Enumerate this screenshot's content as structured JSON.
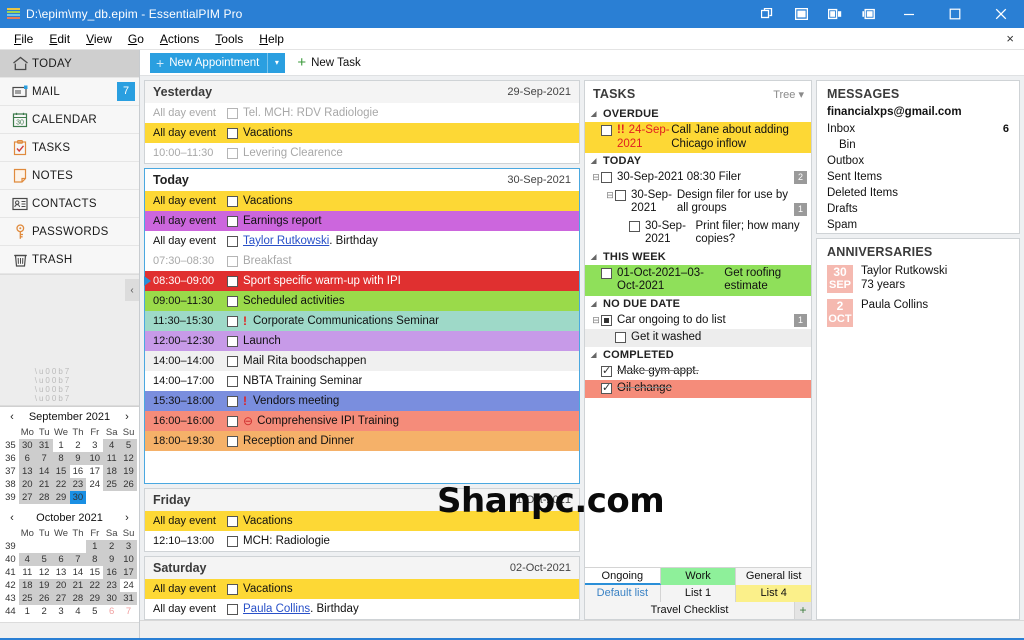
{
  "window": {
    "title": "D:\\epim\\my_db.epim - EssentialPIM Pro",
    "controls": [
      "restore-layout",
      "single-pane",
      "two-pane",
      "side-pane",
      "minimize",
      "maximize",
      "close"
    ]
  },
  "menu": {
    "items": [
      "File",
      "Edit",
      "View",
      "Go",
      "Actions",
      "Tools",
      "Help"
    ],
    "close_label": "×"
  },
  "sidebar": {
    "items": [
      {
        "label": "TODAY",
        "icon": "home-icon",
        "badge": ""
      },
      {
        "label": "MAIL",
        "icon": "envelope-icon",
        "badge": "7"
      },
      {
        "label": "CALENDAR",
        "icon": "calendar-icon",
        "badge": ""
      },
      {
        "label": "TASKS",
        "icon": "clipboard-check-icon",
        "badge": ""
      },
      {
        "label": "NOTES",
        "icon": "note-page-icon",
        "badge": ""
      },
      {
        "label": "CONTACTS",
        "icon": "contact-card-icon",
        "badge": ""
      },
      {
        "label": "PASSWORDS",
        "icon": "key-icon",
        "badge": ""
      },
      {
        "label": "TRASH",
        "icon": "trash-icon",
        "badge": ""
      }
    ],
    "collapse_label": "‹"
  },
  "minicalendars": [
    {
      "title": "September 2021",
      "prev": "‹",
      "next": "›",
      "daynames": [
        "Mo",
        "Tu",
        "We",
        "Th",
        "Fr",
        "Sa",
        "Su"
      ],
      "weeks": [
        {
          "wk": "35",
          "days": [
            {
              "n": "30",
              "cls": "out shade"
            },
            {
              "n": "31",
              "cls": "out shade"
            },
            {
              "n": "1",
              "cls": ""
            },
            {
              "n": "2",
              "cls": ""
            },
            {
              "n": "3",
              "cls": ""
            },
            {
              "n": "4",
              "cls": "sat shade"
            },
            {
              "n": "5",
              "cls": "sun shade"
            }
          ]
        },
        {
          "wk": "36",
          "days": [
            {
              "n": "6",
              "cls": "shade"
            },
            {
              "n": "7",
              "cls": "shade"
            },
            {
              "n": "8",
              "cls": "shade"
            },
            {
              "n": "9",
              "cls": "shade"
            },
            {
              "n": "10",
              "cls": "shade"
            },
            {
              "n": "11",
              "cls": "sat shade"
            },
            {
              "n": "12",
              "cls": "sun shade"
            }
          ]
        },
        {
          "wk": "37",
          "days": [
            {
              "n": "13",
              "cls": "shade"
            },
            {
              "n": "14",
              "cls": "shade"
            },
            {
              "n": "15",
              "cls": "shade"
            },
            {
              "n": "16",
              "cls": ""
            },
            {
              "n": "17",
              "cls": ""
            },
            {
              "n": "18",
              "cls": "sat shade"
            },
            {
              "n": "19",
              "cls": "sun shade"
            }
          ]
        },
        {
          "wk": "38",
          "days": [
            {
              "n": "20",
              "cls": "shade"
            },
            {
              "n": "21",
              "cls": "shade"
            },
            {
              "n": "22",
              "cls": "shade"
            },
            {
              "n": "23",
              "cls": "shade"
            },
            {
              "n": "24",
              "cls": ""
            },
            {
              "n": "25",
              "cls": "sat shade"
            },
            {
              "n": "26",
              "cls": "sun shade"
            }
          ]
        },
        {
          "wk": "39",
          "days": [
            {
              "n": "27",
              "cls": "shade"
            },
            {
              "n": "28",
              "cls": "shade"
            },
            {
              "n": "29",
              "cls": "shade"
            },
            {
              "n": "30",
              "cls": "today"
            },
            {
              "n": "",
              "cls": ""
            },
            {
              "n": "",
              "cls": ""
            },
            {
              "n": "",
              "cls": ""
            }
          ]
        }
      ]
    },
    {
      "title": "October 2021",
      "prev": "‹",
      "next": "›",
      "daynames": [
        "Mo",
        "Tu",
        "We",
        "Th",
        "Fr",
        "Sa",
        "Su"
      ],
      "weeks": [
        {
          "wk": "39",
          "days": [
            {
              "n": "",
              "cls": ""
            },
            {
              "n": "",
              "cls": ""
            },
            {
              "n": "",
              "cls": ""
            },
            {
              "n": "",
              "cls": ""
            },
            {
              "n": "1",
              "cls": "shade"
            },
            {
              "n": "2",
              "cls": "sat shade"
            },
            {
              "n": "3",
              "cls": "sun shade"
            }
          ]
        },
        {
          "wk": "40",
          "days": [
            {
              "n": "4",
              "cls": "shade"
            },
            {
              "n": "5",
              "cls": "shade"
            },
            {
              "n": "6",
              "cls": "shade"
            },
            {
              "n": "7",
              "cls": "shade"
            },
            {
              "n": "8",
              "cls": "shade"
            },
            {
              "n": "9",
              "cls": "sat shade"
            },
            {
              "n": "10",
              "cls": "sun shade"
            }
          ]
        },
        {
          "wk": "41",
          "days": [
            {
              "n": "11",
              "cls": ""
            },
            {
              "n": "12",
              "cls": ""
            },
            {
              "n": "13",
              "cls": ""
            },
            {
              "n": "14",
              "cls": ""
            },
            {
              "n": "15",
              "cls": ""
            },
            {
              "n": "16",
              "cls": "sat shade"
            },
            {
              "n": "17",
              "cls": "sun shade"
            }
          ]
        },
        {
          "wk": "42",
          "days": [
            {
              "n": "18",
              "cls": "shade"
            },
            {
              "n": "19",
              "cls": "shade"
            },
            {
              "n": "20",
              "cls": "shade"
            },
            {
              "n": "21",
              "cls": "shade"
            },
            {
              "n": "22",
              "cls": "shade"
            },
            {
              "n": "23",
              "cls": "sat shade"
            },
            {
              "n": "24",
              "cls": "sun"
            }
          ]
        },
        {
          "wk": "43",
          "days": [
            {
              "n": "25",
              "cls": "shade"
            },
            {
              "n": "26",
              "cls": "shade"
            },
            {
              "n": "27",
              "cls": "shade"
            },
            {
              "n": "28",
              "cls": "shade"
            },
            {
              "n": "29",
              "cls": "shade"
            },
            {
              "n": "30",
              "cls": "sat shade"
            },
            {
              "n": "31",
              "cls": "sun shade"
            }
          ]
        },
        {
          "wk": "44",
          "days": [
            {
              "n": "1",
              "cls": "out"
            },
            {
              "n": "2",
              "cls": "out"
            },
            {
              "n": "3",
              "cls": "out"
            },
            {
              "n": "4",
              "cls": "out"
            },
            {
              "n": "5",
              "cls": "out"
            },
            {
              "n": "6",
              "cls": "out sat"
            },
            {
              "n": "7",
              "cls": "out sun"
            }
          ]
        }
      ]
    }
  ],
  "toolbar": {
    "new_appointment": "New Appointment",
    "new_appointment_caret": "▾",
    "new_task": "New Task",
    "plus": "+"
  },
  "appointments": {
    "days": [
      {
        "name": "Yesterday",
        "date": "29-Sep-2021",
        "today": false,
        "items": [
          {
            "time": "All day event",
            "text": "Tel. MCH: RDV Radiologie",
            "bg": "",
            "dim": true,
            "flag": "",
            "link": ""
          },
          {
            "time": "All day event",
            "text": "Vacations",
            "bg": "#fdd835",
            "dim": false,
            "flag": "",
            "link": ""
          },
          {
            "time": "10:00–11:30",
            "text": "Levering Clearence",
            "bg": "",
            "dim": true,
            "flag": "",
            "link": ""
          }
        ]
      },
      {
        "name": "Today",
        "date": "30-Sep-2021",
        "today": true,
        "items": [
          {
            "time": "All day event",
            "text": "Vacations",
            "bg": "#fdd835",
            "dim": false,
            "flag": "",
            "link": ""
          },
          {
            "time": "All day event",
            "text": "Earnings report",
            "bg": "#cc66dd",
            "dim": false,
            "flag": "",
            "link": ""
          },
          {
            "time": "All day event",
            "text": ". Birthday",
            "bg": "",
            "dim": false,
            "flag": "",
            "link": "Taylor Rutkowski"
          },
          {
            "time": "07:30–08:30",
            "text": "Breakfast",
            "bg": "",
            "dim": true,
            "flag": "",
            "link": ""
          },
          {
            "time": "08:30–09:00",
            "text": "Sport specific warm-up with IPI",
            "bg": "#e03030",
            "dim": false,
            "flag": "",
            "link": "",
            "white": true,
            "marker": true
          },
          {
            "time": "09:00–11:30",
            "text": "Scheduled activities",
            "bg": "#9ada4a",
            "dim": false,
            "flag": "",
            "link": ""
          },
          {
            "time": "11:30–15:30",
            "text": "Corporate Communications Seminar",
            "bg": "#9ed9c8",
            "dim": false,
            "flag": "!",
            "link": ""
          },
          {
            "time": "12:00–12:30",
            "text": "Launch",
            "bg": "#c79ae8",
            "dim": false,
            "flag": "",
            "link": ""
          },
          {
            "time": "14:00–14:00",
            "text": "Mail Rita boodschappen",
            "bg": "#f0f0f0",
            "dim": false,
            "flag": "",
            "link": ""
          },
          {
            "time": "14:00–17:00",
            "text": "NBTA Training Seminar",
            "bg": "",
            "dim": false,
            "flag": "",
            "link": ""
          },
          {
            "time": "15:30–18:00",
            "text": "Vendors meeting",
            "bg": "#7a8ede",
            "dim": false,
            "flag": "!",
            "link": ""
          },
          {
            "time": "16:00–16:00",
            "text": "Comprehensive IPI Training",
            "bg": "#f58c7a",
            "dim": false,
            "flag": "⊖",
            "link": ""
          },
          {
            "time": "18:00–19:30",
            "text": "Reception and Dinner",
            "bg": "#f5b169",
            "dim": false,
            "flag": "",
            "link": ""
          }
        ]
      },
      {
        "name": "Friday",
        "date": "01-Oct-2021",
        "today": false,
        "items": [
          {
            "time": "All day event",
            "text": "Vacations",
            "bg": "#fdd835",
            "dim": false,
            "flag": "",
            "link": ""
          },
          {
            "time": "12:10–13:00",
            "text": "MCH: Radiologie",
            "bg": "",
            "dim": false,
            "flag": "",
            "link": ""
          }
        ]
      },
      {
        "name": "Saturday",
        "date": "02-Oct-2021",
        "today": false,
        "items": [
          {
            "time": "All day event",
            "text": "Vacations",
            "bg": "#fdd835",
            "dim": false,
            "flag": "",
            "link": ""
          },
          {
            "time": "All day event",
            "text": ". Birthday",
            "bg": "",
            "dim": false,
            "flag": "",
            "link": "Paula Collins"
          }
        ]
      }
    ]
  },
  "tasks": {
    "title": "TASKS",
    "view_mode": "Tree",
    "view_caret": "▾",
    "groups": [
      {
        "label": "OVERDUE",
        "items": [
          {
            "indent": 0,
            "date": "24-Sep-2021",
            "text": "Call Jane about adding Chicago inflow",
            "bg": "#fdd835",
            "priority": "!!",
            "overdue": true,
            "count": "",
            "checkbox": "empty",
            "expander": ""
          }
        ]
      },
      {
        "label": "TODAY",
        "items": [
          {
            "indent": 0,
            "date": "30-Sep-2021 08:30 Filer",
            "text": "",
            "bg": "",
            "priority": "",
            "overdue": false,
            "count": "2",
            "checkbox": "empty",
            "expander": "−"
          },
          {
            "indent": 1,
            "date": "30-Sep-2021",
            "text": "Design filer for use by all groups",
            "bg": "",
            "priority": "",
            "overdue": false,
            "count": "1",
            "checkbox": "empty",
            "expander": "−"
          },
          {
            "indent": 2,
            "date": "30-Sep-2021",
            "text": "Print filer; how many copies?",
            "bg": "",
            "priority": "",
            "overdue": false,
            "count": "",
            "checkbox": "empty",
            "expander": ""
          }
        ]
      },
      {
        "label": "THIS WEEK",
        "items": [
          {
            "indent": 0,
            "date": "01-Oct-2021–03-Oct-2021",
            "text": "Get roofing estimate",
            "bg": "#8fe05a",
            "priority": "",
            "overdue": false,
            "count": "",
            "checkbox": "empty",
            "expander": ""
          }
        ]
      },
      {
        "label": "NO DUE DATE",
        "items": [
          {
            "indent": 0,
            "date": "",
            "text": "Car ongoing to do list",
            "bg": "",
            "priority": "",
            "overdue": false,
            "count": "1",
            "checkbox": "partial",
            "expander": "−"
          },
          {
            "indent": 1,
            "date": "",
            "text": "Get it washed",
            "bg": "#ededed",
            "priority": "",
            "overdue": false,
            "count": "",
            "checkbox": "empty",
            "expander": ""
          }
        ]
      },
      {
        "label": "COMPLETED",
        "items": [
          {
            "indent": 0,
            "date": "",
            "text": "Make gym appt.",
            "bg": "",
            "priority": "",
            "overdue": false,
            "count": "",
            "checkbox": "checked",
            "expander": "",
            "done": true
          },
          {
            "indent": 0,
            "date": "",
            "text": "Oil change",
            "bg": "#f58c7a",
            "priority": "",
            "overdue": false,
            "count": "",
            "checkbox": "checked",
            "expander": "",
            "done": true
          }
        ]
      }
    ],
    "list_tabs_row1": [
      {
        "label": "Ongoing",
        "bg": "#ffffff",
        "selected": true
      },
      {
        "label": "Work",
        "bg": "#8ef09a",
        "selected": false
      },
      {
        "label": "General list",
        "bg": "#f4f4f4",
        "selected": false
      }
    ],
    "list_tabs_row2": [
      {
        "label": "Default list",
        "bg": "#f4f4f4",
        "selected": false,
        "muted": true
      },
      {
        "label": "List 1",
        "bg": "#f4f4f4",
        "selected": false,
        "muted": false
      },
      {
        "label": "List 4",
        "bg": "#fbf08a",
        "selected": false,
        "muted": false
      }
    ],
    "list_tabs_row3": {
      "label": "Travel Checklist",
      "add": "+"
    }
  },
  "messages": {
    "title": "MESSAGES",
    "account": "financialxps@gmail.com",
    "folders": [
      {
        "label": "Inbox",
        "count": "6",
        "sub": false
      },
      {
        "label": "Bin",
        "count": "",
        "sub": true
      },
      {
        "label": "Outbox",
        "count": "",
        "sub": false
      },
      {
        "label": "Sent Items",
        "count": "",
        "sub": false
      },
      {
        "label": "Deleted Items",
        "count": "",
        "sub": false
      },
      {
        "label": "Drafts",
        "count": "",
        "sub": false
      },
      {
        "label": "Spam",
        "count": "",
        "sub": false
      }
    ]
  },
  "anniversaries": {
    "title": "ANNIVERSARIES",
    "items": [
      {
        "day": "30",
        "month": "SEP",
        "name": "Taylor Rutkowski",
        "detail": "73 years"
      },
      {
        "day": "2",
        "month": "OCT",
        "name": "Paula Collins",
        "detail": ""
      }
    ]
  },
  "watermark": "Shanpc.com"
}
